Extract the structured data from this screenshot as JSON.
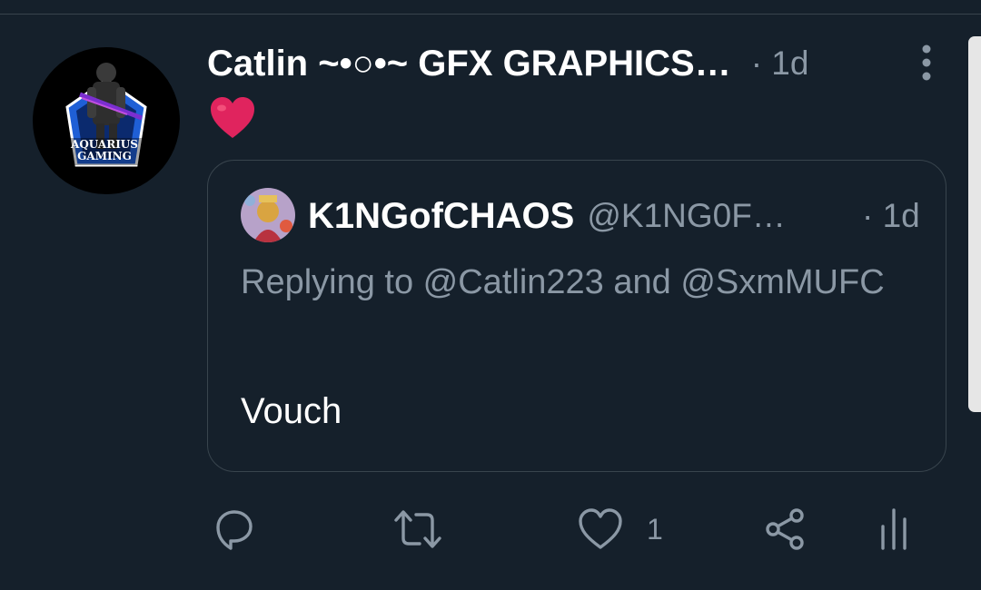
{
  "tweet": {
    "author_name": "Catlin ~•○•~ GFX GRAPHICS…",
    "time": "· 1d",
    "avatar": {
      "icon": "aquarius-gaming-logo-icon",
      "logo_text": "AQUARIUS GAMING"
    },
    "text_emoji": "red-heart-emoji"
  },
  "quote": {
    "author_name": "K1NGofCHAOS",
    "handle": "@K1NG0F…",
    "time": "· 1d",
    "reply_context": "Replying to @Catlin223 and @SxmMUFC",
    "text": "Vouch"
  },
  "actions": {
    "reply_icon": "reply-icon",
    "retweet_icon": "retweet-icon",
    "like_icon": "heart-outline-icon",
    "like_count": "1",
    "share_icon": "share-icon",
    "analytics_icon": "analytics-icon"
  },
  "colors": {
    "background": "#15202b",
    "secondary_text": "#8b98a5",
    "border": "#38444d",
    "heart": "#e0245e"
  }
}
